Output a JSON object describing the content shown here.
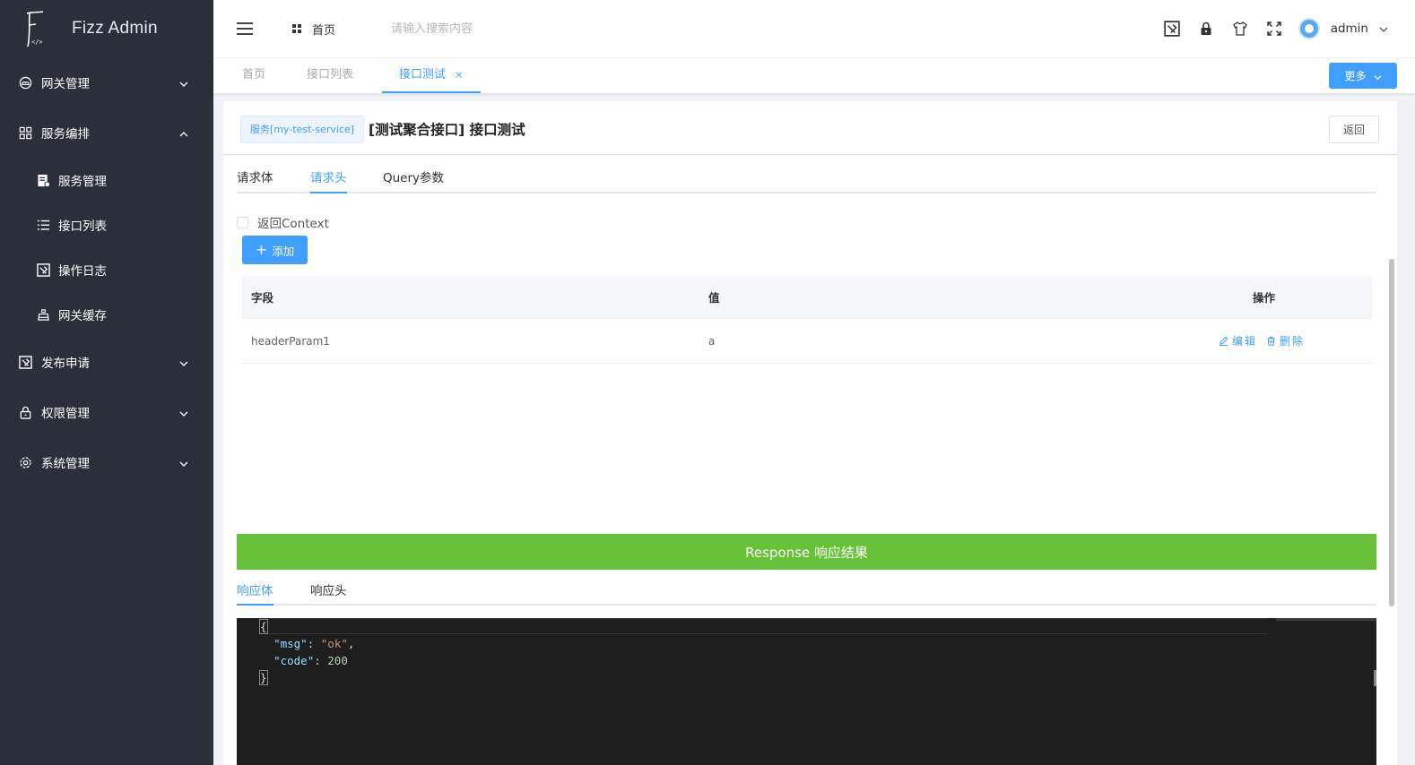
{
  "app": {
    "title": "Fizz Admin"
  },
  "sidebar": {
    "items": [
      {
        "label": "网关管理",
        "icon": "cloud-icon",
        "expanded": false
      },
      {
        "label": "服务编排",
        "icon": "grid-icon",
        "expanded": true,
        "children": [
          {
            "label": "服务管理",
            "icon": "service-doc-icon"
          },
          {
            "label": "接口列表",
            "icon": "list-icon"
          },
          {
            "label": "操作日志",
            "icon": "log-icon"
          },
          {
            "label": "网关缓存",
            "icon": "cache-icon"
          }
        ]
      },
      {
        "label": "发布申请",
        "icon": "publish-icon",
        "expanded": false
      },
      {
        "label": "权限管理",
        "icon": "lock-icon",
        "expanded": false
      },
      {
        "label": "系统管理",
        "icon": "settings-icon",
        "expanded": false
      }
    ]
  },
  "header": {
    "breadcrumb": "首页",
    "search_placeholder": "请输入搜索内容",
    "user": "admin",
    "icons": [
      "publish-icon",
      "lock-icon",
      "shirt-icon",
      "fullscreen-icon"
    ]
  },
  "tabs": {
    "items": [
      {
        "label": "首页",
        "active": false
      },
      {
        "label": "接口列表",
        "active": false
      },
      {
        "label": "接口测试",
        "active": true,
        "closable": true
      }
    ],
    "close_symbol": "×",
    "more_label": "更多"
  },
  "page": {
    "service_tag": "服务[my-test-service]",
    "title": "[测试聚合接口] 接口测试",
    "back_label": "返回",
    "request_tabs": [
      {
        "label": "请求体",
        "active": false
      },
      {
        "label": "请求头",
        "active": true
      },
      {
        "label": "Query参数",
        "active": false
      }
    ],
    "return_context_label": "返回Context",
    "return_context_checked": false,
    "add_label": "添加",
    "table": {
      "columns": [
        "字段",
        "值",
        "操作"
      ],
      "rows": [
        {
          "field": "headerParam1",
          "value": "a",
          "edit": "编辑",
          "delete": "删除"
        }
      ]
    },
    "response_title": "Response 响应结果",
    "response_tabs": [
      {
        "label": "响应体",
        "active": true
      },
      {
        "label": "响应头",
        "active": false
      }
    ],
    "response_body": {
      "open": "{",
      "msg_key": "\"msg\"",
      "msg_val": "\"ok\"",
      "code_key": "\"code\"",
      "code_val": "200",
      "close": "}"
    }
  },
  "colors": {
    "sidebar_bg": "#2b2f3a",
    "primary": "#409eff",
    "success": "#67c23a",
    "editor_bg": "#1e1e1e"
  }
}
